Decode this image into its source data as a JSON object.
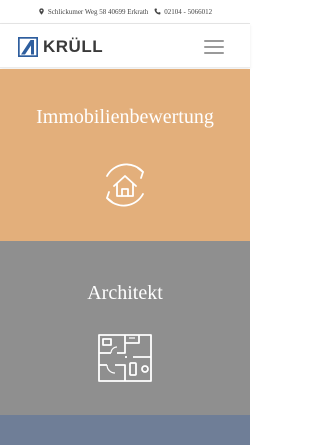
{
  "topbar": {
    "address": "Schlickumer Weg 58 40699 Erkrath",
    "phone": "02104 - 5066012",
    "address_icon": "map-pin-icon",
    "phone_icon": "phone-icon"
  },
  "header": {
    "logo_text": "KRÜLL",
    "menu_icon": "hamburger-menu-icon"
  },
  "tiles": [
    {
      "title": "Immobilienbewertung",
      "icon": "house-cycle-icon",
      "color": "#E3AF7B"
    },
    {
      "title": "Architekt",
      "icon": "floor-plan-icon",
      "color": "#8F8F8F"
    },
    {
      "title": "",
      "color": "#6F7E97"
    }
  ],
  "colors": {
    "brand_blue": "#2E5E9E",
    "logo_text": "#3A3A3A"
  }
}
